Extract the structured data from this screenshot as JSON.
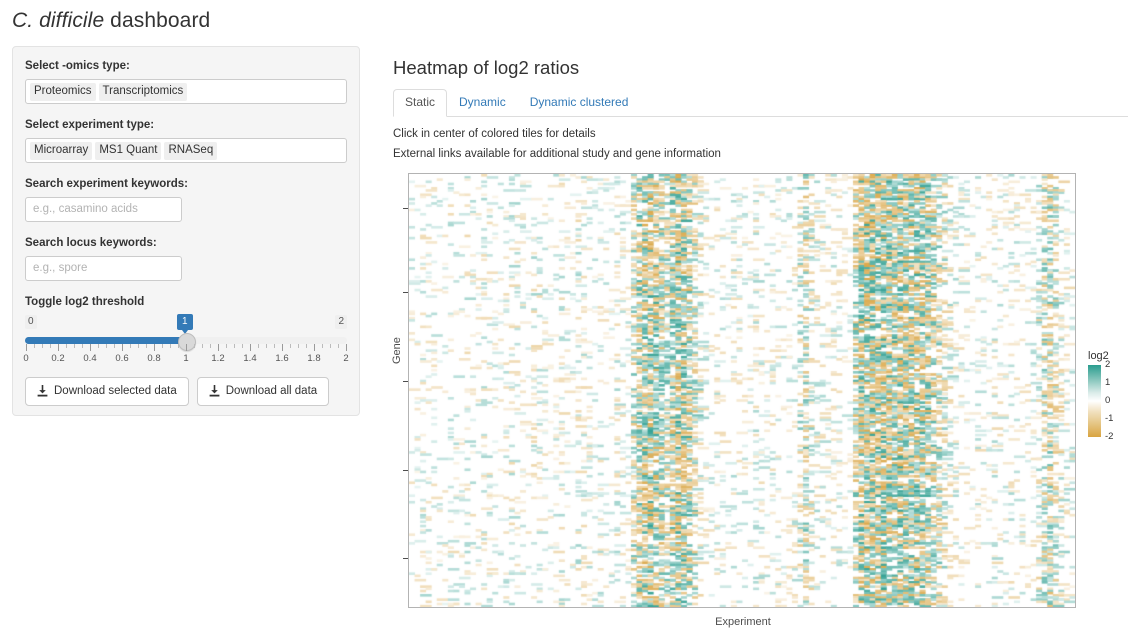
{
  "page": {
    "title_italic": "C. difficile",
    "title_rest": " dashboard"
  },
  "sidebar": {
    "omics": {
      "label": "Select -omics type:",
      "chips": [
        "Proteomics",
        "Transcriptomics"
      ]
    },
    "experiment": {
      "label": "Select experiment type:",
      "chips": [
        "Microarray",
        "MS1 Quant",
        "RNASeq"
      ]
    },
    "experiment_search": {
      "label": "Search experiment keywords:",
      "placeholder": "e.g., casamino acids",
      "value": ""
    },
    "locus_search": {
      "label": "Search locus keywords:",
      "placeholder": "e.g., spore",
      "value": ""
    },
    "slider": {
      "label": "Toggle log2 threshold",
      "min_label": "0",
      "max_label": "2",
      "value_label": "1",
      "min": 0,
      "max": 2,
      "value": 1,
      "tick_labels": [
        "0",
        "0.2",
        "0.4",
        "0.6",
        "0.8",
        "1",
        "1.2",
        "1.4",
        "1.6",
        "1.8",
        "2"
      ],
      "fill_color": "#337ab7"
    },
    "buttons": {
      "download_selected": "Download selected data",
      "download_all": "Download all data"
    }
  },
  "main": {
    "title": "Heatmap of log2 ratios",
    "tabs": [
      {
        "label": "Static",
        "active": true
      },
      {
        "label": "Dynamic",
        "active": false
      },
      {
        "label": "Dynamic clustered",
        "active": false
      }
    ],
    "hints": [
      "Click in center of colored tiles for details",
      "External links available for additional study and gene information"
    ]
  },
  "chart_data": {
    "type": "heatmap",
    "title": "Heatmap of log2 ratios",
    "xlabel": "Experiment",
    "ylabel": "Gene",
    "grid": false,
    "legend_position": "right",
    "colorbar": {
      "title": "log2",
      "ticks": [
        "2",
        "1",
        "0",
        "-1",
        "-2"
      ],
      "tick_values": [
        2,
        1,
        0,
        -1,
        -2
      ],
      "vmin": -2,
      "vmax": 2,
      "colors": {
        "high": "#2a9d8f",
        "mid": "#ffffff",
        "low": "#d9a441"
      }
    },
    "n_columns": 120,
    "n_rows": 200,
    "value_range": [
      -2,
      2
    ],
    "column_density": [
      0.12,
      0.1,
      0.22,
      0.18,
      0.14,
      0.1,
      0.08,
      0.2,
      0.16,
      0.12,
      0.24,
      0.18,
      0.14,
      0.22,
      0.16,
      0.1,
      0.12,
      0.2,
      0.24,
      0.18,
      0.14,
      0.1,
      0.26,
      0.2,
      0.16,
      0.12,
      0.18,
      0.22,
      0.14,
      0.1,
      0.28,
      0.22,
      0.18,
      0.14,
      0.2,
      0.16,
      0.12,
      0.24,
      0.18,
      0.14,
      0.55,
      0.78,
      0.88,
      0.92,
      0.85,
      0.72,
      0.6,
      0.8,
      0.9,
      0.86,
      0.7,
      0.52,
      0.3,
      0.18,
      0.14,
      0.2,
      0.16,
      0.12,
      0.22,
      0.18,
      0.14,
      0.1,
      0.24,
      0.18,
      0.14,
      0.2,
      0.16,
      0.12,
      0.18,
      0.22,
      0.45,
      0.62,
      0.4,
      0.24,
      0.18,
      0.14,
      0.22,
      0.18,
      0.14,
      0.1,
      0.72,
      0.88,
      0.94,
      0.9,
      0.86,
      0.92,
      0.88,
      0.84,
      0.9,
      0.86,
      0.82,
      0.88,
      0.84,
      0.78,
      0.7,
      0.58,
      0.42,
      0.3,
      0.22,
      0.18,
      0.14,
      0.1,
      0.2,
      0.16,
      0.12,
      0.22,
      0.18,
      0.14,
      0.24,
      0.2,
      0.16,
      0.12,
      0.18,
      0.4,
      0.58,
      0.66,
      0.52,
      0.34,
      0.22,
      0.16
    ]
  }
}
